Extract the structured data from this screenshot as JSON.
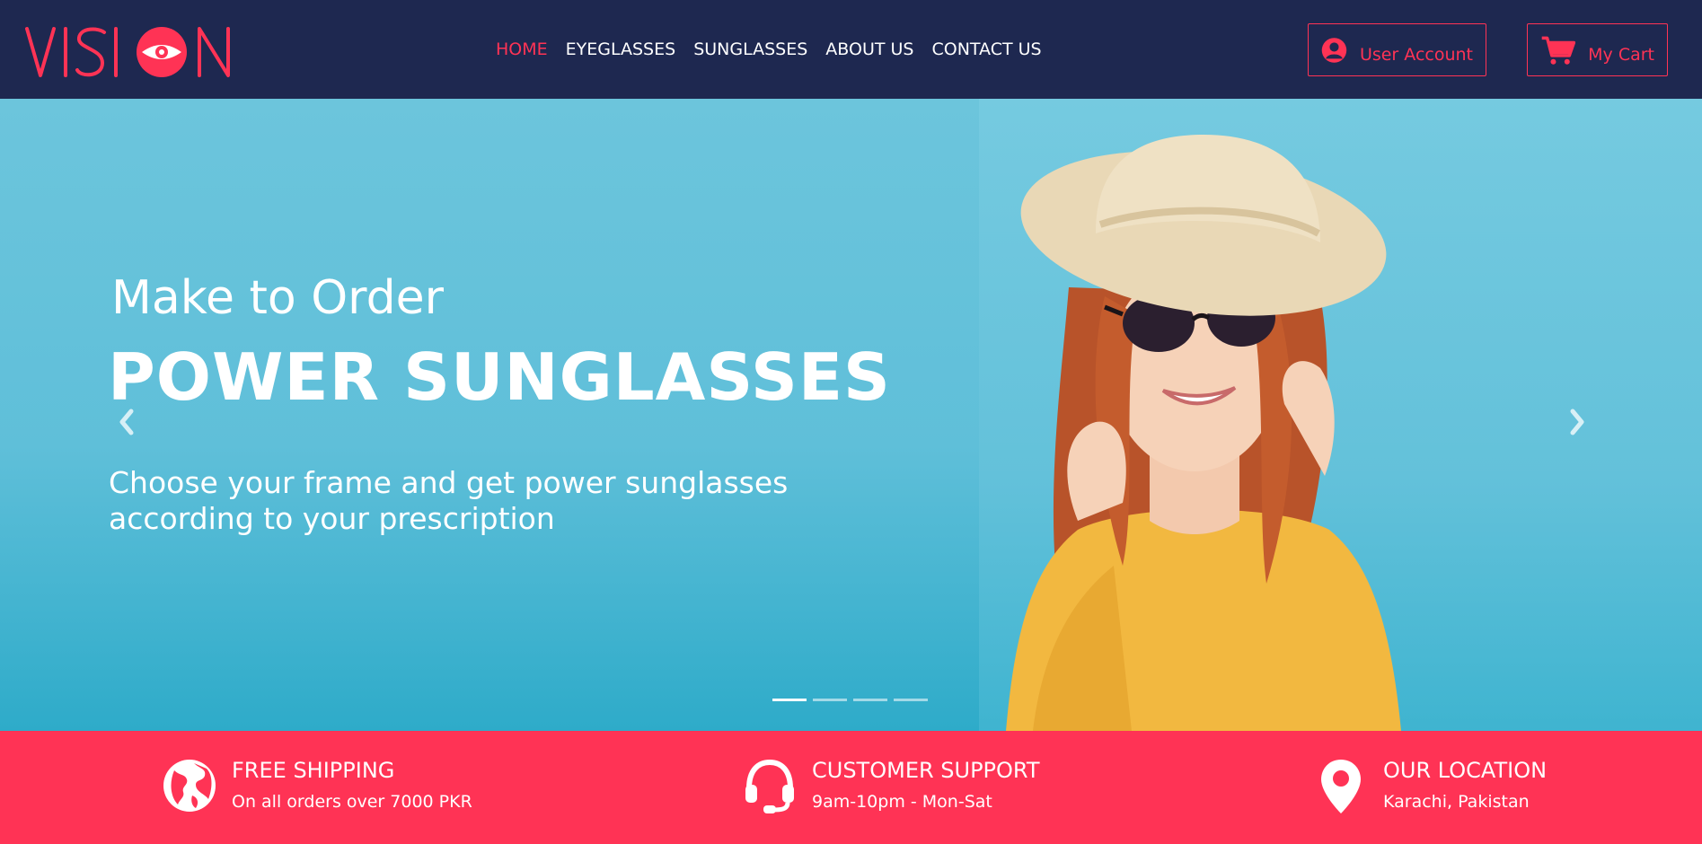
{
  "brand": {
    "logo_text": "VISION",
    "accent_color": "#ff3355",
    "header_bg": "#1e2850"
  },
  "nav": {
    "items": [
      {
        "label": "HOME",
        "active": true
      },
      {
        "label": "EYEGLASSES",
        "active": false
      },
      {
        "label": "SUNGLASSES",
        "active": false
      },
      {
        "label": "ABOUT US",
        "active": false
      },
      {
        "label": "CONTACT US",
        "active": false
      }
    ]
  },
  "header_actions": {
    "account": {
      "label": "User Account",
      "icon": "user-circle-icon"
    },
    "cart": {
      "label": "My Cart",
      "icon": "cart-icon"
    }
  },
  "hero": {
    "kicker": "Make to Order",
    "title": "POWER SUNGLASSES",
    "subtitle": "Choose your frame and get power sunglasses according to your prescription",
    "slide_count": 4,
    "active_slide": 1,
    "bg_color": "#5fbfd9"
  },
  "features": [
    {
      "title": "FREE SHIPPING",
      "subtitle": "On all orders over 7000 PKR",
      "icon": "globe-icon"
    },
    {
      "title": "CUSTOMER SUPPORT",
      "subtitle": "9am-10pm - Mon-Sat",
      "icon": "headset-icon"
    },
    {
      "title": "OUR LOCATION",
      "subtitle": "Karachi, Pakistan",
      "icon": "map-pin-icon"
    }
  ]
}
